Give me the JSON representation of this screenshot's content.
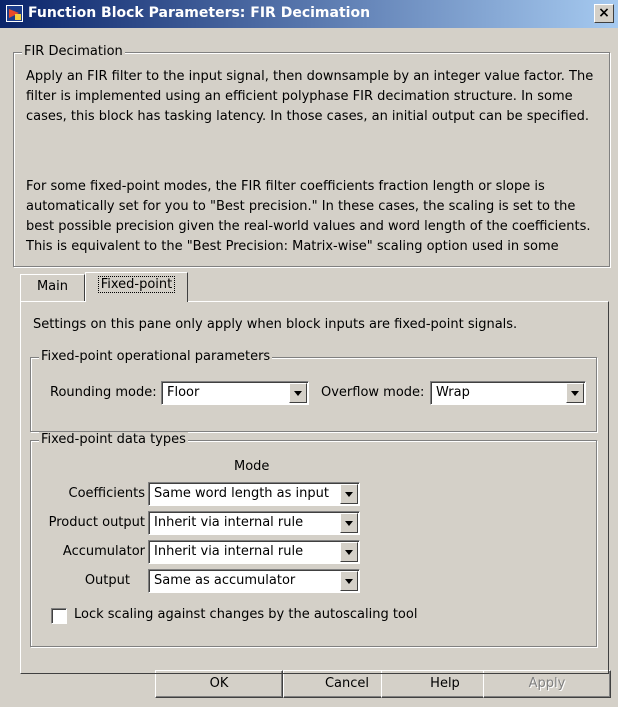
{
  "window": {
    "title": "Function Block Parameters: FIR Decimation",
    "close_symbol": "×"
  },
  "description": {
    "group_title": "FIR Decimation",
    "paragraphs": [
      "Apply an FIR filter to the input signal, then downsample by an integer value factor. The filter is implemented using an efficient polyphase FIR decimation structure.  In some cases, this block has tasking latency.  In those cases, an initial output can be specified.",
      "For some fixed-point modes, the FIR filter coefficients fraction length or slope is automatically set for you to \"Best precision.\" In these cases, the scaling is set to the best possible precision given the real-world values and word length of the coefficients. This is equivalent to the \"Best Precision: Matrix-wise\" scaling option used in some"
    ]
  },
  "tabs": [
    {
      "label": "Main",
      "active": false
    },
    {
      "label": "Fixed-point",
      "active": true
    }
  ],
  "panel": {
    "note": "Settings on this pane only apply when block inputs are fixed-point signals.",
    "operational": {
      "title": "Fixed-point operational parameters",
      "rounding_label": "Rounding mode:",
      "rounding_value": "Floor",
      "overflow_label": "Overflow mode:",
      "overflow_value": "Wrap"
    },
    "datatypes": {
      "title": "Fixed-point data types",
      "mode_header": "Mode",
      "rows": [
        {
          "label": "Coefficients",
          "value": "Same word length as input"
        },
        {
          "label": "Product output",
          "value": "Inherit via internal rule"
        },
        {
          "label": "Accumulator",
          "value": "Inherit via internal rule"
        },
        {
          "label": "Output",
          "value": "Same as accumulator"
        }
      ],
      "lock_label": "Lock scaling against changes by the autoscaling tool",
      "lock_checked": false
    }
  },
  "buttons": {
    "ok": "OK",
    "cancel": "Cancel",
    "help": "Help",
    "apply": "Apply"
  },
  "colors": {
    "title_start": "#0a246a",
    "title_end": "#a6caf0",
    "face": "#d4d0c8"
  },
  "icons": {
    "app": "simulink-block-icon",
    "close": "close-icon",
    "dropdown": "chevron-down-icon"
  }
}
